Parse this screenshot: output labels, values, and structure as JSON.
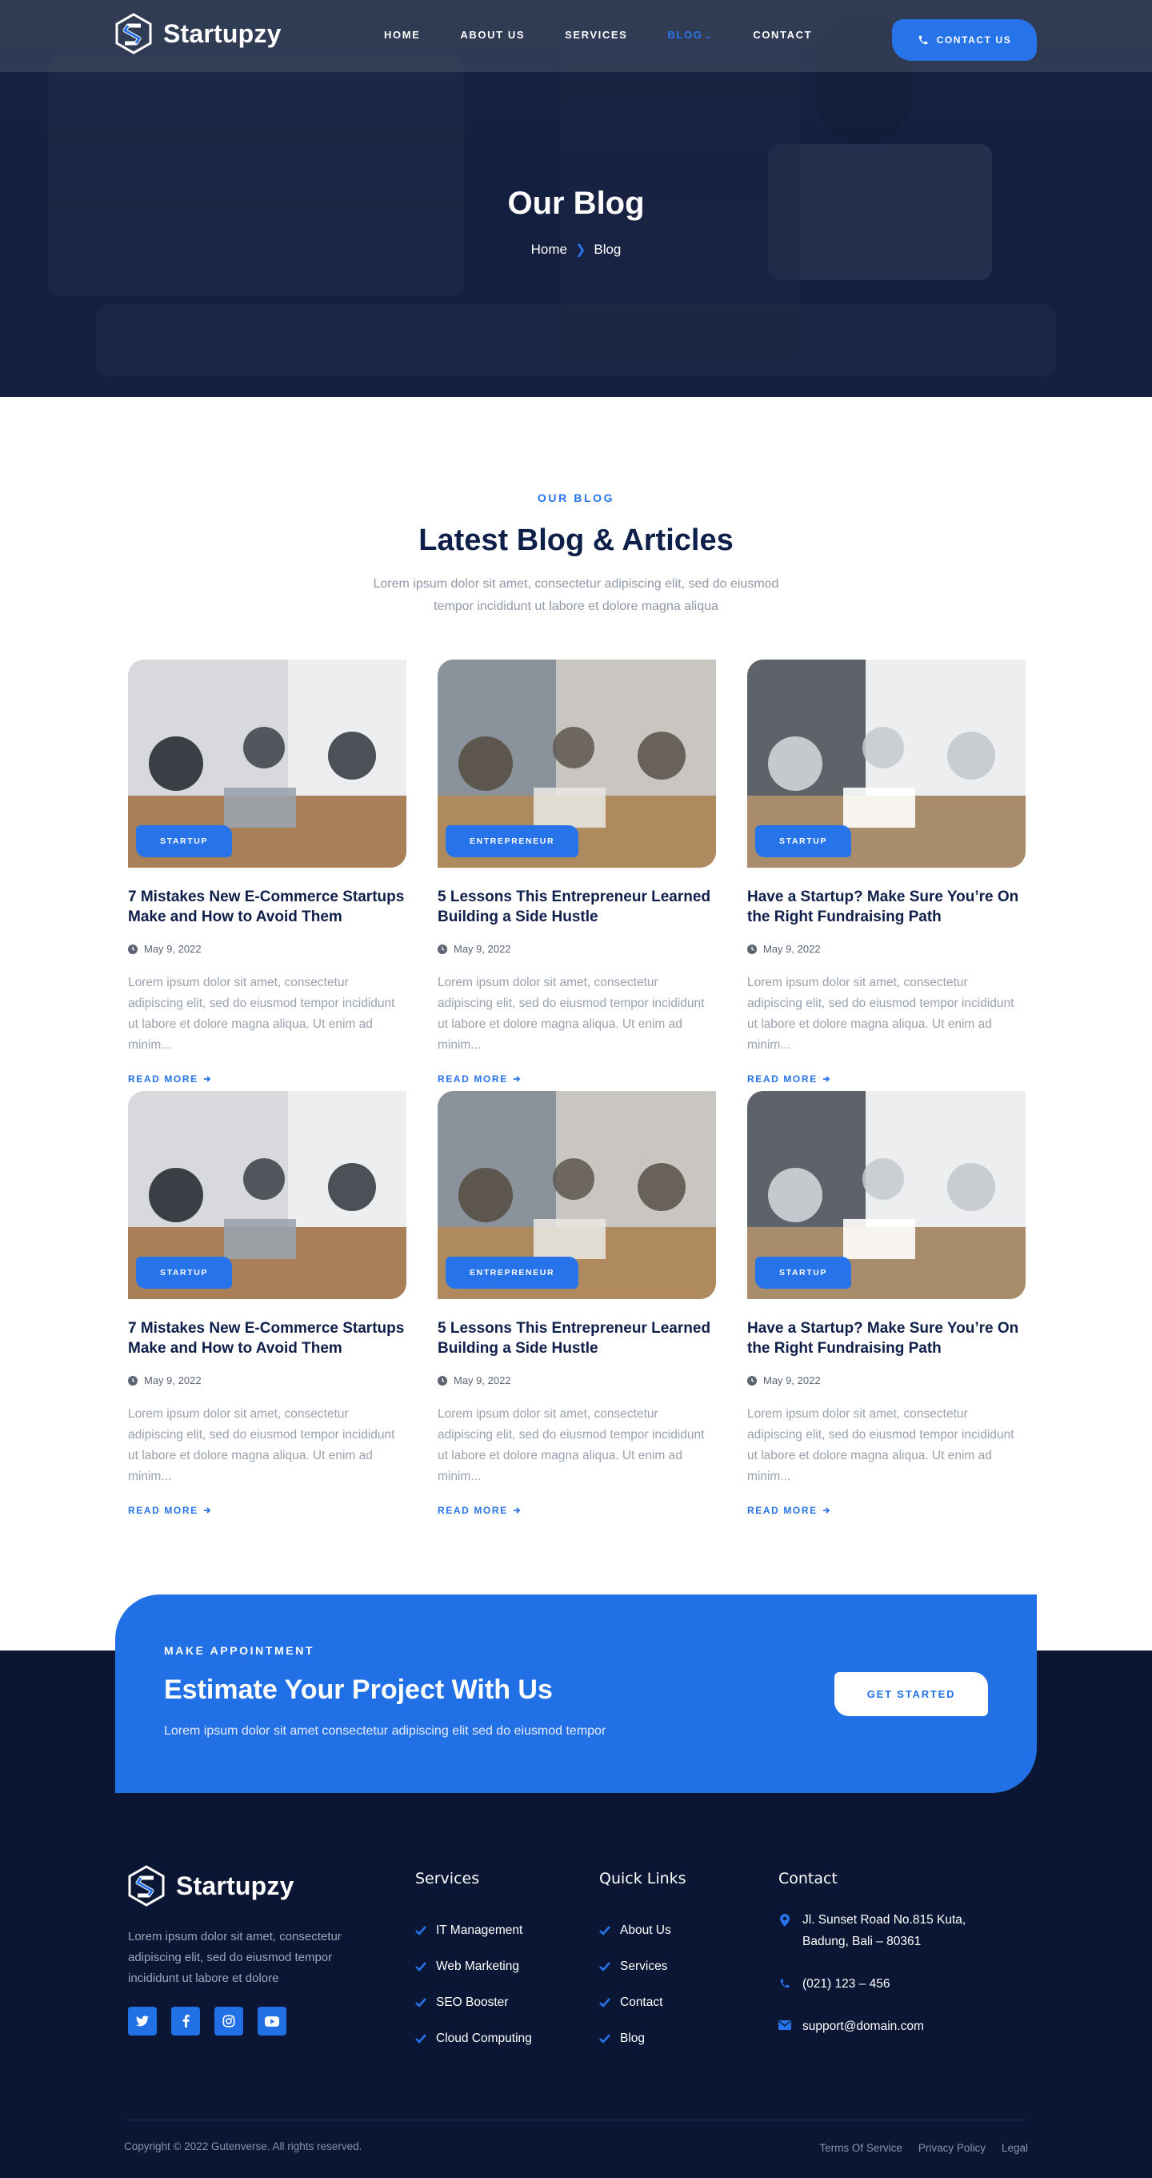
{
  "brand": {
    "name": "Startupzy"
  },
  "nav": {
    "items": [
      {
        "label": "HOME"
      },
      {
        "label": "ABOUT US"
      },
      {
        "label": "SERVICES"
      },
      {
        "label": "BLOG"
      },
      {
        "label": "CONTACT"
      }
    ],
    "active_index": 3,
    "contact_button": "CONTACT US"
  },
  "hero": {
    "title": "Our Blog",
    "breadcrumb": {
      "home": "Home",
      "current": "Blog"
    }
  },
  "blog": {
    "eyebrow": "OUR BLOG",
    "title": "Latest Blog & Articles",
    "subtitle": "Lorem ipsum dolor sit amet, consectetur adipiscing elit, sed do eiusmod tempor incididunt ut labore et dolore magna aliqua",
    "read_more": "READ MORE",
    "posts": [
      {
        "category": "STARTUP",
        "title": "7 Mistakes New E-Commerce Startups Make and How to Avoid Them",
        "date": "May 9, 2022",
        "excerpt": "Lorem ipsum dolor sit amet, consectetur adipiscing elit, sed do eiusmod tempor incididunt ut labore et dolore magna aliqua. Ut enim ad minim..."
      },
      {
        "category": "ENTREPRENEUR",
        "title": "5 Lessons This Entrepreneur Learned Building a Side Hustle",
        "date": "May 9, 2022",
        "excerpt": "Lorem ipsum dolor sit amet, consectetur adipiscing elit, sed do eiusmod tempor incididunt ut labore et dolore magna aliqua. Ut enim ad minim..."
      },
      {
        "category": "STARTUP",
        "title": "Have a Startup? Make Sure You’re On the Right Fundraising Path",
        "date": "May 9, 2022",
        "excerpt": "Lorem ipsum dolor sit amet, consectetur adipiscing elit, sed do eiusmod tempor incididunt ut labore et dolore magna aliqua. Ut enim ad minim..."
      },
      {
        "category": "STARTUP",
        "title": "7 Mistakes New E-Commerce Startups Make and How to Avoid Them",
        "date": "May 9, 2022",
        "excerpt": "Lorem ipsum dolor sit amet, consectetur adipiscing elit, sed do eiusmod tempor incididunt ut labore et dolore magna aliqua. Ut enim ad minim..."
      },
      {
        "category": "ENTREPRENEUR",
        "title": "5 Lessons This Entrepreneur Learned Building a Side Hustle",
        "date": "May 9, 2022",
        "excerpt": "Lorem ipsum dolor sit amet, consectetur adipiscing elit, sed do eiusmod tempor incididunt ut labore et dolore magna aliqua. Ut enim ad minim..."
      },
      {
        "category": "STARTUP",
        "title": "Have a Startup? Make Sure You’re On the Right Fundraising Path",
        "date": "May 9, 2022",
        "excerpt": "Lorem ipsum dolor sit amet, consectetur adipiscing elit, sed do eiusmod tempor incididunt ut labore et dolore magna aliqua. Ut enim ad minim..."
      }
    ]
  },
  "cta": {
    "eyebrow": "MAKE APPOINTMENT",
    "title": "Estimate Your Project With Us",
    "text": "Lorem ipsum dolor sit amet consectetur adipiscing elit sed do eiusmod tempor",
    "button": "GET STARTED"
  },
  "footer": {
    "about": "Lorem ipsum dolor sit amet, consectetur adipiscing elit, sed do eiusmod tempor incididunt ut labore et dolore",
    "socials": [
      "twitter-icon",
      "facebook-icon",
      "instagram-icon",
      "youtube-icon"
    ],
    "services": {
      "title": "Services",
      "items": [
        "IT Management",
        "Web Marketing",
        "SEO Booster",
        "Cloud Computing"
      ]
    },
    "quick_links": {
      "title": "Quick Links",
      "items": [
        "About Us",
        "Services",
        "Contact",
        "Blog"
      ]
    },
    "contact": {
      "title": "Contact",
      "address_line1": "Jl. Sunset Road No.815 Kuta,",
      "address_line2": "Badung, Bali – 80361",
      "phone": "(021) 123 – 456",
      "email": "support@domain.com"
    },
    "copyright": "Copyright © 2022 Gutenverse. All rights reserved.",
    "legal": [
      "Terms Of Service",
      "Privacy Policy",
      "Legal"
    ]
  },
  "colors": {
    "accent": "#2773ea",
    "navy": "#0e1f4a",
    "footer_bg": "#0a1633"
  }
}
